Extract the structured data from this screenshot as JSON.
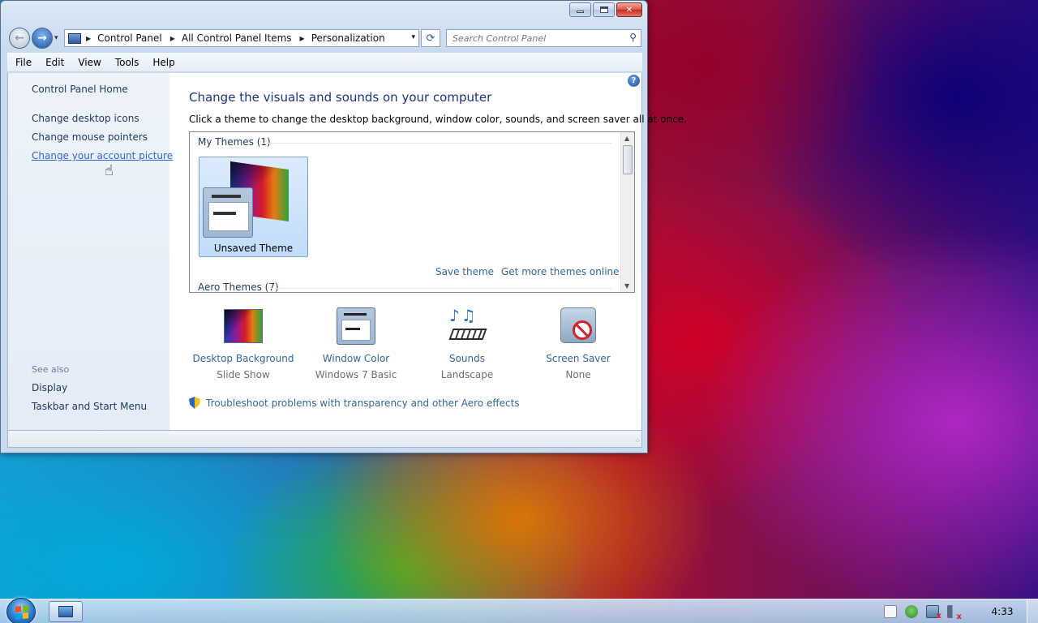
{
  "window": {
    "caption_min": "",
    "caption_max": "",
    "caption_close": "✕"
  },
  "nav": {
    "back_glyph": "←",
    "forward_glyph": "→",
    "dropdown_glyph": "▾",
    "breadcrumbs": [
      "Control Panel",
      "All Control Panel Items",
      "Personalization"
    ],
    "breadcrumb_sep": "▶",
    "refresh_glyph": "⟳",
    "search_placeholder": "Search Control Panel",
    "search_glyph": "⚲"
  },
  "menu": {
    "items": [
      "File",
      "Edit",
      "View",
      "Tools",
      "Help"
    ]
  },
  "left_pane": {
    "home": "Control Panel Home",
    "links": [
      "Change desktop icons",
      "Change mouse pointers",
      "Change your account picture"
    ],
    "see_also_label": "See also",
    "see_also_links": [
      "Display",
      "Taskbar and Start Menu"
    ]
  },
  "main": {
    "help_glyph": "?",
    "title": "Change the visuals and sounds on your computer",
    "description": "Click a theme to change the desktop background, window color, sounds, and screen saver all at once.",
    "themes": {
      "my_themes_header": "My Themes (1)",
      "selected_theme_name": "Unsaved Theme",
      "save_theme": "Save theme",
      "get_more": "Get more themes online",
      "aero_header": "Aero Themes (7)",
      "scroll_up": "▲",
      "scroll_down": "▼"
    },
    "customize": [
      {
        "label": "Desktop Background",
        "value": "Slide Show",
        "icon": "desktop-background-icon"
      },
      {
        "label": "Window Color",
        "value": "Windows 7 Basic",
        "icon": "window-color-icon"
      },
      {
        "label": "Sounds",
        "value": "Landscape",
        "icon": "sounds-icon"
      },
      {
        "label": "Screen Saver",
        "value": "None",
        "icon": "screen-saver-icon"
      }
    ],
    "troubleshoot": "Troubleshoot problems with transparency and other Aero effects"
  },
  "statusbar": {
    "grip": "⁘"
  },
  "taskbar": {
    "clock": "4:33"
  },
  "colors": {
    "link": "#336699",
    "title": "#1e3287",
    "active_link": "#3366cc"
  }
}
